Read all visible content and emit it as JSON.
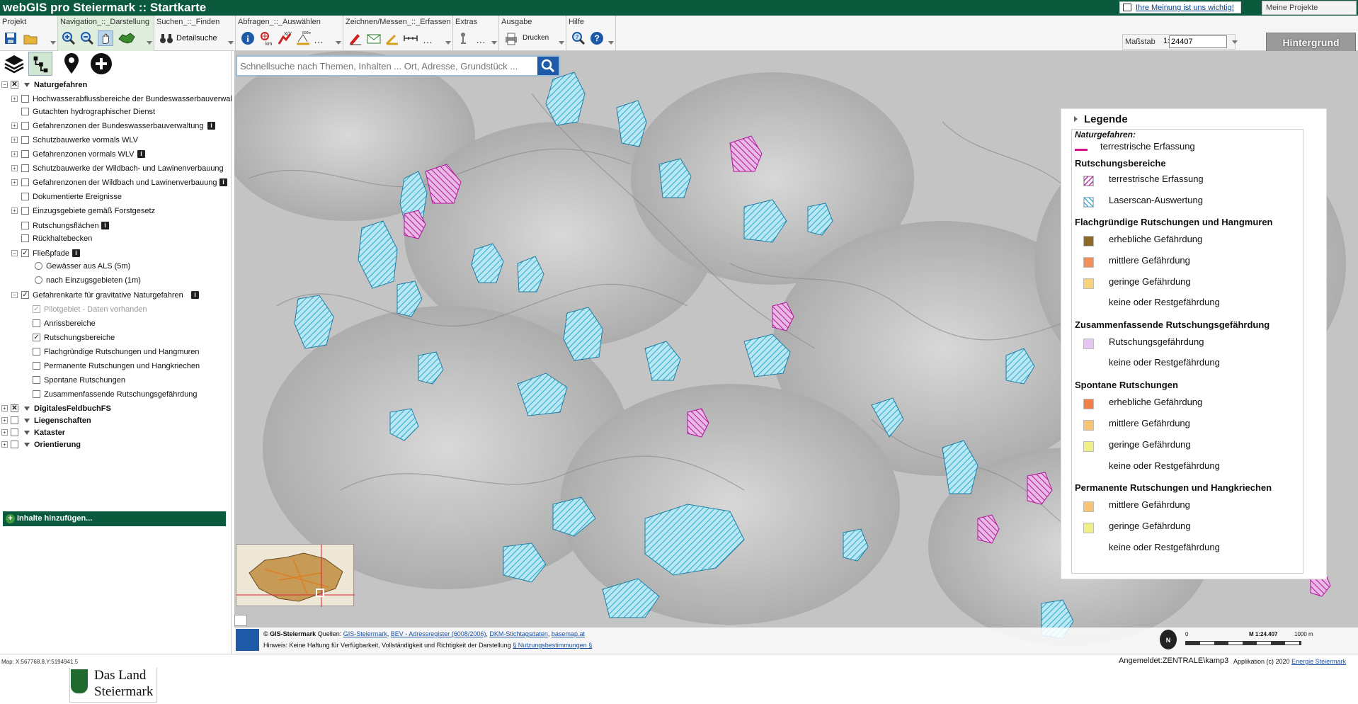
{
  "app": {
    "title": "webGIS pro Steiermark ::  Startkarte",
    "feedback": "Ihre Meinung ist uns wichtig!",
    "projects": "Meine Projekte"
  },
  "toolbar": {
    "groups": {
      "projekt": "Projekt",
      "navigation": "Navigation_::_Darstellung",
      "suchen": "Suchen_::_Finden",
      "abfragen": "Abfragen_::_Auswählen",
      "zeichnen": "Zeichnen/Messen_::_Erfassen",
      "extras": "Extras",
      "ausgabe": "Ausgabe",
      "hilfe": "Hilfe"
    },
    "detailsuche": "Detailsuche",
    "drucken": "Drucken",
    "scale_label": "Maßstab",
    "scale_prefix": "1:",
    "scale_value": "24407",
    "background": "Hintergrund"
  },
  "search": {
    "placeholder": "Schnellsuche nach Themen, Inhalten ... Ort, Adresse, Grundstück ..."
  },
  "tree": {
    "naturgefahren": "Naturgefahren",
    "hochwasser": "Hochwasserabflussbereiche der Bundeswasserbauverwal",
    "gutachten": "Gutachten hydrographischer Dienst",
    "gz_bwv": "Gefahrenzonen der Bundeswasserbauverwaltung",
    "schutz_wlv": "Schutzbauwerke vormals WLV",
    "gz_wlv": "Gefahrenzonen vormals WLV",
    "schutz_wildbach": "Schutzbauwerke der Wildbach- und Lawinenverbauung",
    "gz_wildbach": "Gefahrenzonen der Wildbach und Lawinenverbauung",
    "dokumentierte": "Dokumentierte Ereignisse",
    "einzugsgebiete": "Einzugsgebiete gemäß Forstgesetz",
    "rutschungsflaechen": "Rutschungsflächen",
    "rueckhaltebecken": "Rückhaltebecken",
    "fliesspfade": "Fließpfade",
    "gewaesser": "Gewässer aus ALS (5m)",
    "nach_einzugsgebieten": "nach Einzugsgebieten (1m)",
    "gefahrenkarte": "Gefahrenkarte für gravitative Naturgefahren",
    "pilotgebiet": "Pilotgebiet - Daten vorhanden",
    "anrissbereiche": "Anrissbereiche",
    "rutschungsbereiche": "Rutschungsbereiche",
    "flachgruendige": "Flachgründige Rutschungen und Hangmuren",
    "permanente": "Permanente Rutschungen und Hangkriechen",
    "spontane": "Spontane Rutschungen",
    "zusammenfassende": "Zusammenfassende Rutschungsgefährdung",
    "digitales": "DigitalesFeldbuchFS",
    "liegenschaften": "Liegenschaften",
    "kataster": "Kataster",
    "orientierung": "Orientierung",
    "add_content": "Inhalte hinzufügen..."
  },
  "logo": {
    "line1": "Das Land",
    "line2": "Steiermark"
  },
  "legend": {
    "title": "Legende",
    "subtitle": "Naturgefahren:",
    "terrestrisch_line": "terrestrische Erfassung",
    "rutschungsbereiche": {
      "title": "Rutschungsbereiche",
      "item1": "terrestrische Erfassung",
      "item2": "Laserscan-Auswertung"
    },
    "flachgruendige": {
      "title": "Flachgründige Rutschungen und Hangmuren",
      "item1": "erhebliche Gefährdung",
      "item2": "mittlere Gefährdung",
      "item3": "geringe Gefährdung",
      "item4": "keine oder Restgefährdung"
    },
    "zusammenfassende": {
      "title": "Zusammenfassende Rutschungsgefährdung",
      "item1": "Rutschungsgefährdung",
      "item2": "keine oder Restgefährdung"
    },
    "spontane": {
      "title": "Spontane Rutschungen",
      "item1": "erhebliche Gefährdung",
      "item2": "mittlere Gefährdung",
      "item3": "geringe Gefährdung",
      "item4": "keine oder Restgefährdung"
    },
    "permanente": {
      "title": "Permanente Rutschungen und Hangkriechen",
      "item1": "mittlere Gefährdung",
      "item2": "geringe Gefährdung",
      "item3": "keine oder Restgefährdung"
    }
  },
  "colors": {
    "brand_green": "#0b5a3e",
    "terrestrial_magenta": "#d0128c",
    "laserscan_cyan": "#3ab7d8",
    "erheblich_brown": "#8b6a2a",
    "mittlere_orange": "#f0905a",
    "geringe_yellow": "#f6d27a",
    "rutschungsgefaehrdung_lilac": "#e6c6f2",
    "spontan_erheblich": "#f07f48",
    "spontan_mittlere": "#f6c474",
    "spontan_geringe": "#f0ee8a",
    "perm_mittlere": "#f6c474",
    "perm_geringe": "#f0ee8a"
  },
  "attribution": {
    "copyright": "© GIS-Steiermark",
    "sources_label": "Quellen:",
    "src1": "GIS-Steiermark",
    "src2": "BEV - Adressregister (6008/2006)",
    "src3": "DKM-Stichtagsdaten",
    "src4": "basemap.at",
    "hint": "Hinweis: Keine Haftung für Verfügbarkeit, Vollständigkeit und Richtigkeit der Darstellung",
    "hint_link": "§ Nutzungsbestimmungen §"
  },
  "scalebar": {
    "zero": "0",
    "mid": "M 1:24.407",
    "end": "1000 m"
  },
  "north": "N",
  "status": {
    "coords": "Map: X:567768.8,Y:5194941.5",
    "logged_in": "Angemeldet:ZENTRALE\\kamp3",
    "app_info": "Applikation (c) 2020",
    "app_info_link": "Energie Steiermark"
  }
}
